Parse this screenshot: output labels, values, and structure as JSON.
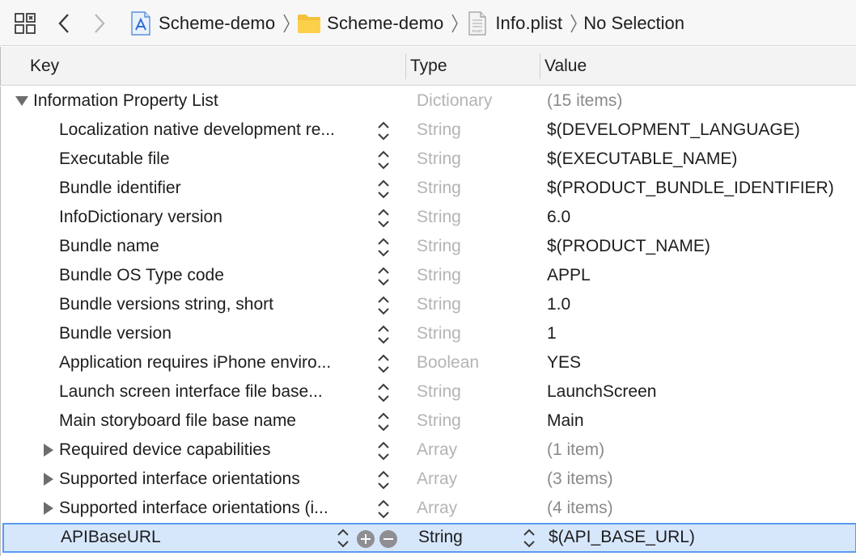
{
  "jumpbar": {
    "crumbs": [
      {
        "label": "Scheme-demo",
        "icon": "xcode-project-icon"
      },
      {
        "label": "Scheme-demo",
        "icon": "folder-icon"
      },
      {
        "label": "Info.plist",
        "icon": "plist-file-icon"
      }
    ],
    "no_selection": "No Selection"
  },
  "header": {
    "key": "Key",
    "type": "Type",
    "value": "Value"
  },
  "rows": [
    {
      "key": "Information Property List",
      "type": "Dictionary",
      "value": "(15 items)"
    },
    {
      "key": "Localization native development re...",
      "type": "String",
      "value": "$(DEVELOPMENT_LANGUAGE)"
    },
    {
      "key": "Executable file",
      "type": "String",
      "value": "$(EXECUTABLE_NAME)"
    },
    {
      "key": "Bundle identifier",
      "type": "String",
      "value": "$(PRODUCT_BUNDLE_IDENTIFIER)"
    },
    {
      "key": "InfoDictionary version",
      "type": "String",
      "value": "6.0"
    },
    {
      "key": "Bundle name",
      "type": "String",
      "value": "$(PRODUCT_NAME)"
    },
    {
      "key": "Bundle OS Type code",
      "type": "String",
      "value": "APPL"
    },
    {
      "key": "Bundle versions string, short",
      "type": "String",
      "value": "1.0"
    },
    {
      "key": "Bundle version",
      "type": "String",
      "value": "1"
    },
    {
      "key": "Application requires iPhone enviro...",
      "type": "Boolean",
      "value": "YES"
    },
    {
      "key": "Launch screen interface file base...",
      "type": "String",
      "value": "LaunchScreen"
    },
    {
      "key": "Main storyboard file base name",
      "type": "String",
      "value": "Main"
    },
    {
      "key": "Required device capabilities",
      "type": "Array",
      "value": "(1 item)"
    },
    {
      "key": "Supported interface orientations",
      "type": "Array",
      "value": "(3 items)"
    },
    {
      "key": "Supported interface orientations (i...",
      "type": "Array",
      "value": "(4 items)"
    },
    {
      "key": "APIBaseURL",
      "type": "String",
      "value": "$(API_BASE_URL)"
    }
  ],
  "colors": {
    "selection_fill": "#d7e7fb",
    "selection_border": "#5b9af0",
    "dim_text": "#b4b4b4"
  }
}
